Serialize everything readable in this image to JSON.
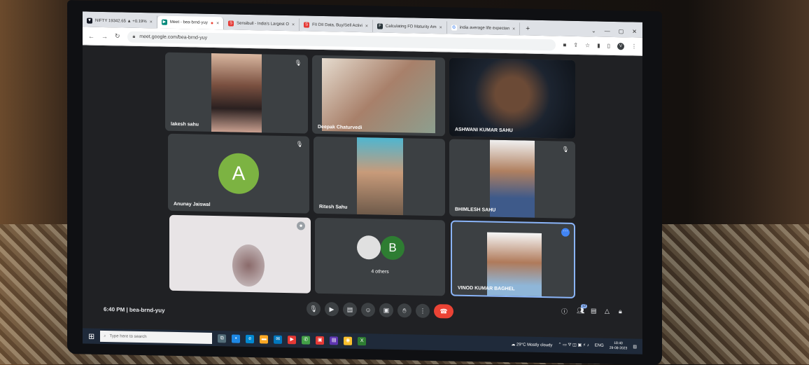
{
  "browser": {
    "tabs": [
      {
        "label": "NIFTY 19342.65 ▲ +0.19%",
        "favicon": "tradingview-icon",
        "color": "#131722"
      },
      {
        "label": "Meet - bea-brnd-yuy",
        "favicon": "meet-icon",
        "color": "#00897b",
        "active": true
      },
      {
        "label": "Sensibull - India's Largest O",
        "favicon": "sensibull-icon",
        "color": "#e53935"
      },
      {
        "label": "FII DII Data, Buy/Sell Activi",
        "favicon": "sensibull-icon",
        "color": "#e53935"
      },
      {
        "label": "Calculating FD Maturity Am",
        "favicon": "doc-icon",
        "color": "#263238"
      },
      {
        "label": "india average life expectan",
        "favicon": "google-icon",
        "color": "#4285f4"
      }
    ],
    "url": "meet.google.com/bea-brnd-yuy",
    "profile_initial": "V"
  },
  "meet": {
    "participants": [
      {
        "name": "lakesh sahu",
        "muted": true
      },
      {
        "name": "Deepak Chaturvedi"
      },
      {
        "name": "ASHWANI KUMAR SAHU"
      },
      {
        "name": "Anunay Jaiswal",
        "avatar_letter": "A",
        "avatar_color": "#7cb342",
        "muted": true
      },
      {
        "name": "Ritesh Sahu"
      },
      {
        "name": "BHIMLESH SAHU",
        "muted": true
      },
      {
        "name": ""
      },
      {
        "name": "4 others",
        "avatar_letter": "B",
        "avatar_color": "#2e7d32"
      },
      {
        "name": "VINOD KUMAR BAGHEL"
      }
    ],
    "time": "6:40 PM",
    "meeting_code": "bea-brnd-yuy",
    "people_count": "12"
  },
  "taskbar": {
    "search_placeholder": "Type here to search",
    "weather": "29°C  Mostly cloudy",
    "lang": "ENG",
    "clock_time": "18:40",
    "clock_date": "29-08-2023"
  }
}
